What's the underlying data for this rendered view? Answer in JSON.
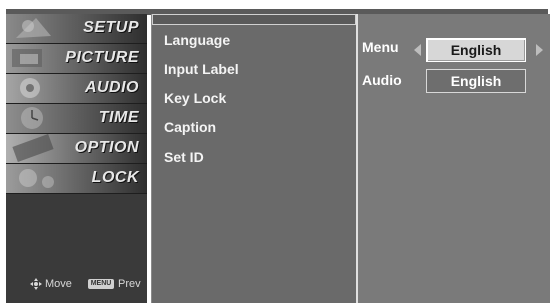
{
  "left_menu": {
    "items": [
      {
        "label": "SETUP"
      },
      {
        "label": "PICTURE"
      },
      {
        "label": "AUDIO"
      },
      {
        "label": "TIME"
      },
      {
        "label": "OPTION"
      },
      {
        "label": "LOCK"
      }
    ],
    "hints": {
      "move_icon": "four-way-arrow-icon",
      "move_label": "Move",
      "menu_key": "MENU",
      "prev_label": "Prev"
    }
  },
  "submenu": {
    "items": [
      {
        "label": "Language"
      },
      {
        "label": "Input Label"
      },
      {
        "label": "Key Lock"
      },
      {
        "label": "Caption"
      },
      {
        "label": "Set ID"
      }
    ]
  },
  "language_panel": {
    "menu_label": "Menu",
    "menu_value": "English",
    "audio_label": "Audio",
    "audio_value": "English"
  },
  "colors": {
    "menu_bg": "#3a3a3a",
    "submenu_bg": "#6a6a6a",
    "panel_bg": "#7a7a7a",
    "selected_bg": "#d7d7d7"
  }
}
